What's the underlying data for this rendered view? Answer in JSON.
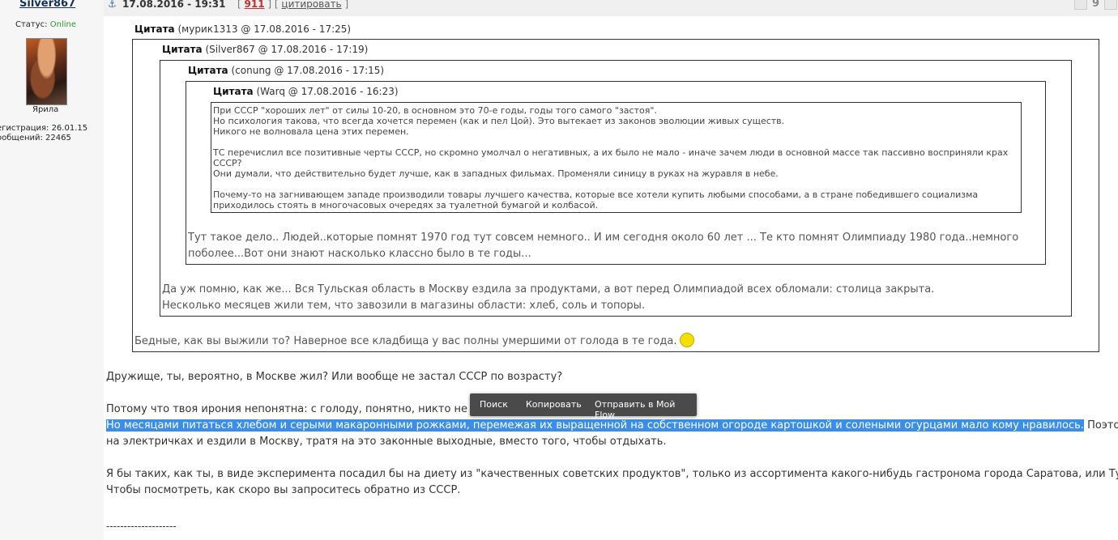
{
  "user": {
    "name": "Silver867",
    "status_label": "Статус:",
    "status_value": "Online",
    "rank": "Ярила",
    "registration": "егистрация: 26.01.15",
    "messages": "ообщений: 22465"
  },
  "post": {
    "date": "17.08.2016 - 19:31",
    "bracket_open": "[",
    "number": "911",
    "bracket_mid": "] [",
    "quote_link": "цитировать",
    "bracket_close": "]",
    "page_count": "9"
  },
  "quotes": {
    "q1": {
      "label": "Цитата",
      "meta": "(мурик1313 @ 17.08.2016 - 17:25)",
      "text": "Бедные, как вы выжили то? Наверное все кладбища у вас полны умершими от голода в те года."
    },
    "q2": {
      "label": "Цитата",
      "meta": "(Silver867 @ 17.08.2016 - 17:19)",
      "line1": "Да уж помню, как же... Вся Тульская область в Москву ездила за продуктами, а вот перед Олимпиадой всех обломали: столица закрыта.",
      "line2": "Несколько месяцев жили тем, что завозили в магазины области: хлеб, соль и топоры."
    },
    "q3": {
      "label": "Цитата",
      "meta": "(conung @ 17.08.2016 - 17:15)",
      "line1": "Тут такое дело.. Людей..которые помнят 1970 год тут совсем немного.. И им сегодня около 60 лет ... Те кто помнят Олимпиаду 1980 года..немного",
      "line2": "поболее...Вот они знают насколько классно было в те годы..."
    },
    "q4": {
      "label": "Цитата",
      "meta": "(Warq @ 17.08.2016 - 16:23)",
      "l1": "При СССР \"хороших лет\" от силы 10-20, в основном это 70-е годы, годы того самого \"застоя\".",
      "l2": "Но психология такова, что всегда хочется перемен (как и пел Цой). Это вытекает из законов эволюции живых существ.",
      "l3": "Никого не волновала цена этих перемен.",
      "l4": "ТС перечислил все позитивные черты СССР, но скромно умолчал о негативных, а их было не мало - иначе зачем люди в основной массе так пассивно восприняли крах",
      "l5": "СССР?",
      "l6": "Они думали, что действительно будет лучше, как в западных фильмах. Променяли синицу в руках на журавля в небе.",
      "l7": "Почему-то на загнивающем западе производили товары лучшего качества, которые все хотели купить любыми способами, а в стране победившего социализма",
      "l8": "приходилось стоять в многочасовых очередях за туалетной бумагой и колбасой."
    }
  },
  "body": {
    "p1": "Дружище, ты, вероятно, в Москве жил? Или вообще не застал СССР по возрасту?",
    "p2": "Потому что твоя ирония непонятна: с голоду, понятно, никто не п",
    "p3_selected": "Но месяцами питаться хлебом и серыми макаронными рожками, перемежая их выращенной на собственном огороде картошкой и солеными огурцами мало кому нравилось.",
    "p3_rest": " Поэтому",
    "p4": "на электричках и ездили в Москву, тратя на это законные выходные, вместо того, чтобы отдыхать.",
    "p5": "Я бы таких, как ты, в виде эксперимента посадил бы на диету из \"качественных советских продуктов\", только из ассортимента какого-нибудь гастронома города Саратова, или Тулы",
    "p6": "Чтобы посмотреть, как скоро вы запроситесь обратно из СССР.",
    "sig_separator": "--------------------"
  },
  "popup": {
    "search": "Поиск",
    "copy": "Копировать",
    "send": "Отправить в Мой Flow"
  },
  "icons": [
    "anchor-icon",
    "smiley-icon"
  ]
}
